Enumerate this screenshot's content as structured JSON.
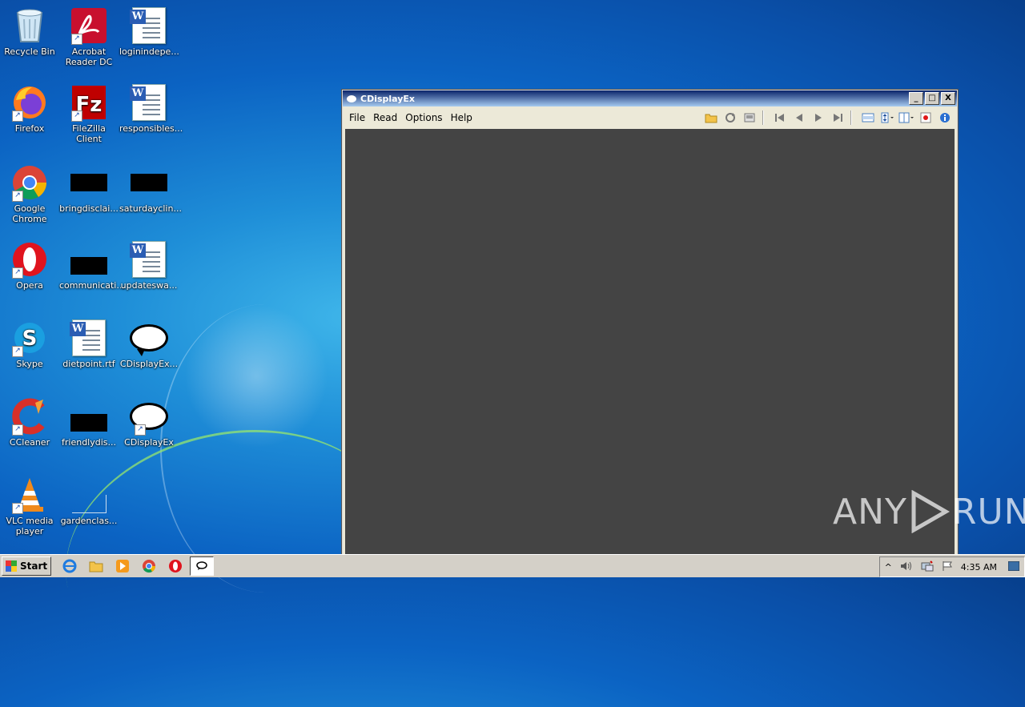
{
  "desktop": {
    "icons": [
      {
        "label": "Recycle Bin"
      },
      {
        "label": "Acrobat Reader DC"
      },
      {
        "label": "loginindepe..."
      },
      {
        "label": "Firefox"
      },
      {
        "label": "FileZilla Client"
      },
      {
        "label": "responsibles..."
      },
      {
        "label": "Google Chrome"
      },
      {
        "label": "bringdisclai..."
      },
      {
        "label": "saturdayclin..."
      },
      {
        "label": "Opera"
      },
      {
        "label": "communicati..."
      },
      {
        "label": "updateswa..."
      },
      {
        "label": "Skype"
      },
      {
        "label": "dietpoint.rtf"
      },
      {
        "label": "CDisplayEx..."
      },
      {
        "label": "CCleaner"
      },
      {
        "label": "friendlydis..."
      },
      {
        "label": "CDisplayEx"
      },
      {
        "label": "VLC media player"
      },
      {
        "label": "gardenclas..."
      }
    ]
  },
  "window": {
    "title": "CDisplayEx",
    "controls": {
      "minimize": "_",
      "maximize": "□",
      "close": "X"
    },
    "menu": [
      "File",
      "Read",
      "Options",
      "Help"
    ],
    "toolbar_icons": [
      "open-folder-icon",
      "refresh-icon",
      "thumbnails-icon",
      "first-page-icon",
      "previous-page-icon",
      "next-page-icon",
      "last-page-icon",
      "fit-width-icon",
      "fit-height-icon",
      "page-layout-icon",
      "record-icon",
      "info-icon"
    ]
  },
  "watermark": {
    "left": "ANY",
    "right": "RUN"
  },
  "taskbar": {
    "start_label": "Start",
    "clock": "4:35 AM",
    "tray_arrow": "^"
  },
  "colors": {
    "viewer_bg": "#444444",
    "titlebar_start": "#0a246a",
    "titlebar_end": "#a6caf0",
    "desktop_blue": "#0b63c3"
  }
}
